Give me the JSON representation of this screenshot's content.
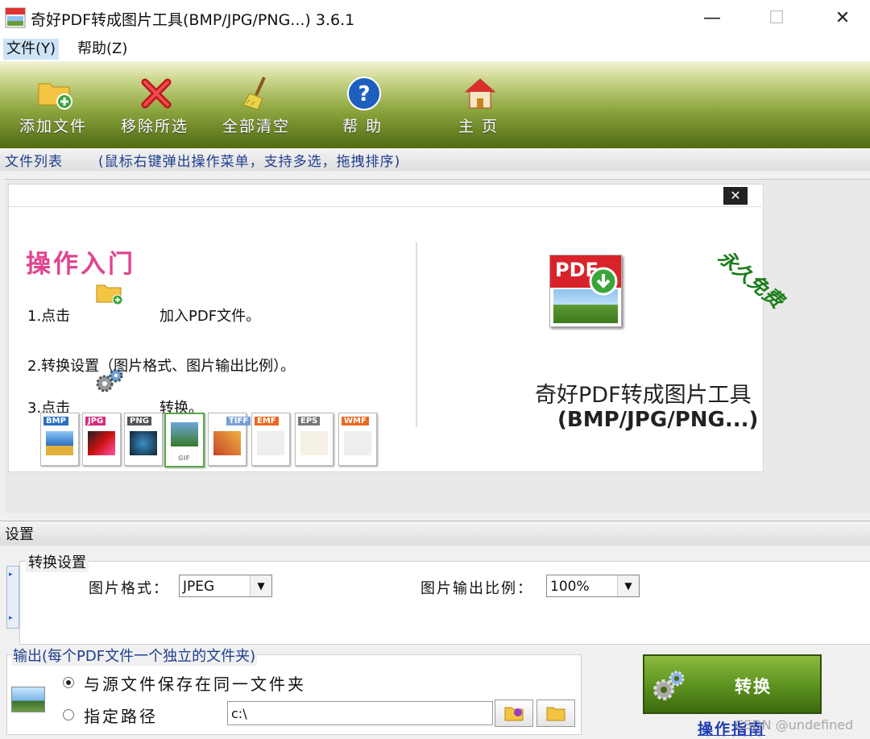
{
  "window": {
    "title": "奇好PDF转成图片工具(BMP/JPG/PNG...) 3.6.1",
    "minimize": "—",
    "maximize": "☐",
    "close": "✕"
  },
  "menu": [
    {
      "label": "文件(Y)"
    },
    {
      "label": "帮助(Z)"
    }
  ],
  "toolbar": [
    {
      "label": "添加文件",
      "icon": "folder-add-icon"
    },
    {
      "label": "移除所选",
      "icon": "red-x-icon"
    },
    {
      "label": "全部清空",
      "icon": "broom-icon"
    },
    {
      "label": "帮 助",
      "icon": "question-icon"
    },
    {
      "label": "主 页",
      "icon": "home-icon"
    }
  ],
  "filelist": {
    "header": "文件列表",
    "hint": "(鼠标右键弹出操作菜单，支持多选，拖拽排序)"
  },
  "guide": {
    "close": "✕",
    "title": "操作入门",
    "step1_a": "1.点击",
    "step1_b": "加入PDF文件。",
    "step2": "2.转换设置（图片格式、图片输出比例）。",
    "step3_a": "3.点击",
    "step3_b": "转换。",
    "free": "永久免费",
    "pdf_icon_text": "PDF",
    "product_line1": "奇好PDF转成图片工具",
    "product_line2": "(BMP/JPG/PNG...)",
    "formats": [
      "BMP",
      "JPG",
      "PNG",
      "GIF",
      "TIFF",
      "EMF",
      "EPS",
      "WMF"
    ]
  },
  "settings": {
    "header": "设置",
    "group": "转换设置",
    "format_label": "图片格式：",
    "format_value": "JPEG",
    "ratio_label": "图片输出比例：",
    "ratio_value": "100%",
    "dropdown_arrow": "▼"
  },
  "output": {
    "legend": "输出(每个PDF文件一个独立的文件夹)",
    "option_same": "与源文件保存在同一文件夹",
    "option_path": "指定路径",
    "selected": "same",
    "path_value": "c:\\"
  },
  "actions": {
    "convert": "转换",
    "guide_link": "操作指南"
  },
  "watermark": "CSDN @undefined",
  "colors": {
    "toolbar_green": "#5e7b1c",
    "accent_pink": "#e0448f",
    "link_blue": "#1f3bb0",
    "hint_blue": "#1f3e8f"
  }
}
